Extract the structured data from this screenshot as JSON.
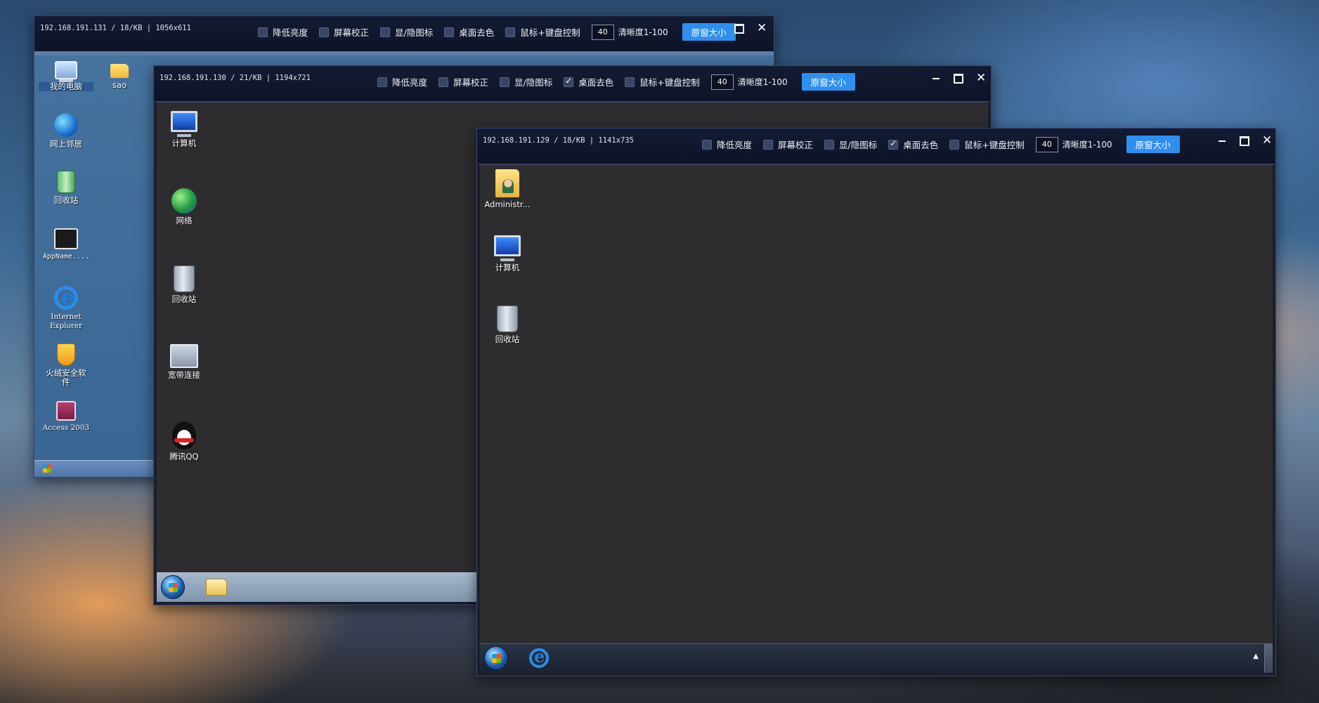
{
  "window_131": {
    "info": "192.168.191.131 / 18/KB | 1056x611",
    "controls": [
      "降低亮度",
      "屏幕校正",
      "显/隐图标",
      "桌面去色",
      "鼠标+键盘控制"
    ],
    "checked": [
      false,
      false,
      false,
      false,
      false
    ],
    "quality": "40",
    "quality_label": "清晰度1-100",
    "orig_button": "原窗大小",
    "icons": {
      "my_computer": "我的电脑",
      "sao": "sao",
      "network": "网上邻居",
      "recycle": "回收站",
      "appname": "AppName....",
      "ie_1": "Internet",
      "ie_2": "Explorer",
      "security_1": "火绒安全软",
      "security_2": "件",
      "access": "Access 2003"
    }
  },
  "window_130": {
    "info": "192.168.191.130 / 21/KB | 1194x721",
    "controls": [
      "降低亮度",
      "屏幕校正",
      "显/隐图标",
      "桌面去色",
      "鼠标+键盘控制"
    ],
    "checked": [
      false,
      false,
      false,
      true,
      false
    ],
    "quality": "40",
    "quality_label": "清晰度1-100",
    "orig_button": "原窗大小",
    "icons": {
      "computer": "计算机",
      "network": "网络",
      "recycle": "回收站",
      "broadband": "宽带连接",
      "qq": "腾讯QQ"
    }
  },
  "window_129": {
    "info": "192.168.191.129 / 18/KB | 1141x735",
    "controls": [
      "降低亮度",
      "屏幕校正",
      "显/隐图标",
      "桌面去色",
      "鼠标+键盘控制"
    ],
    "checked": [
      false,
      false,
      false,
      true,
      false
    ],
    "quality": "40",
    "quality_label": "清晰度1-100",
    "orig_button": "原窗大小",
    "icons": {
      "administrator": "Administr...",
      "computer": "计算机",
      "recycle": "回收站"
    },
    "tray_arrow": "▲"
  },
  "icons": {
    "close": "✕"
  },
  "colors": {
    "titlebar_bg": "#10172b",
    "button_blue": "#2f8ff0",
    "xp_desktop": "#3a6ea5",
    "dark_desktop": "#2d2d30"
  }
}
